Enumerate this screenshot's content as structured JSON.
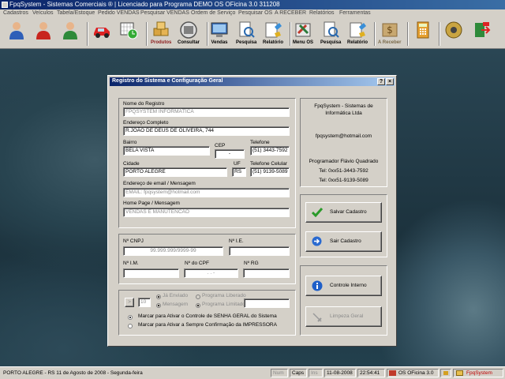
{
  "window": {
    "title": "FpqSystem - Sistemas Comerciais ®  | Licenciado para  Programa DEMO OS OFicina 3.0 311208"
  },
  "menu": [
    "Cadastros",
    "Veículos",
    "Tabela/Estoque",
    "Pedido VENDAS",
    "Pesquisar VENDAS",
    "Ordem de Serviço",
    "Pesquisar OS",
    "A RECEBER",
    "Relatórios",
    "Ferramentas"
  ],
  "toolbar": {
    "produtos": "Produtos",
    "consultar": "Consultar",
    "vendas": "Vendas",
    "pesquisa1": "Pesquisa",
    "relatorio1": "Relatório",
    "menu_os": "Menu OS",
    "pesquisa2": "Pesquisa",
    "relatorio2": "Relatório",
    "a_receber": "A Receber"
  },
  "dialog": {
    "title": "Registro do Sistema e Configuração Geral",
    "help_btn": "?",
    "close_btn": "×",
    "labels": {
      "nome": "Nome do Registro",
      "endereco": "Endereço Completo",
      "bairro": "Bairro",
      "cep": "CEP",
      "telefone": "Telefone",
      "cidade": "Cidade",
      "uf": "UF",
      "celular": "Telefone Celular",
      "email": "Endereço de email / Mensagem",
      "homepage": "Home Page / Mensagem",
      "cnpj": "Nº CNPJ",
      "ie": "Nº I.E.",
      "im": "Nº I.M.",
      "cpf": "Nº do CPF",
      "rg": "Nº RG"
    },
    "values": {
      "nome": "FPQSYSTEM INFORMÁTICA",
      "endereco": "R.JOÃO DE DEUS DE OLIVEIRA, 744",
      "bairro": "BELA VISTA",
      "cep": "-",
      "telefone": "(51) 3443-7592",
      "cidade": "PORTO ALEGRE",
      "uf": "RS",
      "celular": "(51) 9139-5089",
      "email": "EMAIL: fpqsystem@hotmail.com",
      "homepage": "VENDAS E MANUTENCAO",
      "cnpj": "99.999.999/9999-99",
      "ie": "",
      "im": "",
      "cpf": ".   .   -",
      "rg": ""
    },
    "options": {
      "arrow_btn": ">",
      "counter": "10",
      "ja_enviado": "Já Enviado",
      "programa_liberado": "Programa Liberado",
      "mensagem": "Mensagem",
      "programa_limitado": "Programa Limitado",
      "senha_geral": "Marcar para Ativar o Controle de SENHA GERAL do Sistema",
      "impressora": "Marcar para Ativar a Sempre Confirmação da IMPRESSORA"
    },
    "info": {
      "line1": "FpqSystem - Sistemas de",
      "line2": "Informática Ltda",
      "email": "fpqsystem@hotmail.com",
      "programador": "Programador Flávio Quadrado",
      "tel": "Tel: 0xx51-3443-7592",
      "cel": "Tel: 0xx51-9139-5089"
    },
    "buttons": {
      "salvar": "Salvar Cadastro",
      "sair": "Sair Cadastro",
      "controle": "Controle Interno",
      "limpeza": "Limpeza Geral"
    }
  },
  "status": {
    "location_date": "PORTO ALEGRE - RS 11 de Agosto de 2008 - Segunda-feira",
    "num": "Num",
    "caps": "Caps",
    "ins": "Ins",
    "date": "11-08-2008",
    "time": "22:54:41",
    "app": "OS OFicina 3.0",
    "brand": "FpqSystem"
  }
}
